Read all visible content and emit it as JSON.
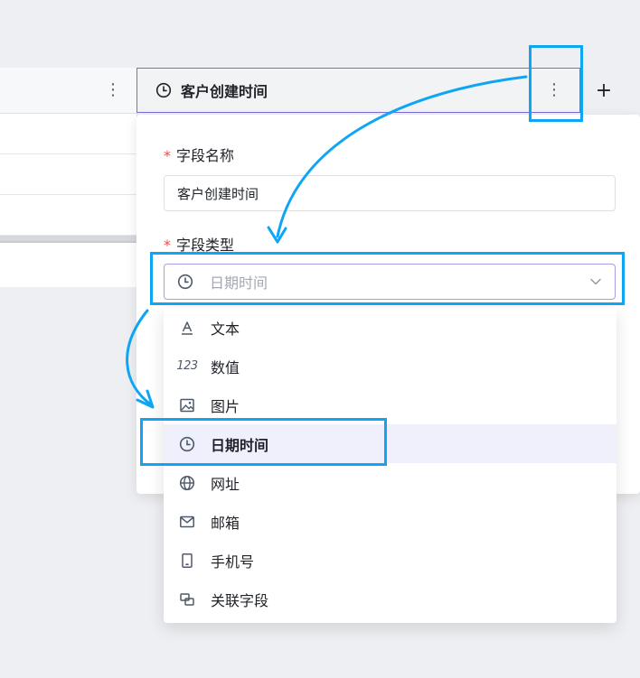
{
  "column": {
    "title": "客户创建时间",
    "add_label": "+"
  },
  "left_table": {
    "more_label": "⋮"
  },
  "popover": {
    "name_label": "字段名称",
    "name_value": "客户创建时间",
    "type_label": "字段类型",
    "type_placeholder": "日期时间",
    "required_mark": "*"
  },
  "field_types": [
    {
      "label": "文本",
      "icon": "text-icon"
    },
    {
      "label": "数值",
      "icon": "number-icon",
      "glyph": "123"
    },
    {
      "label": "图片",
      "icon": "image-icon"
    },
    {
      "label": "日期时间",
      "icon": "clock-icon",
      "selected": true
    },
    {
      "label": "网址",
      "icon": "globe-icon"
    },
    {
      "label": "邮箱",
      "icon": "mail-icon"
    },
    {
      "label": "手机号",
      "icon": "phone-icon"
    },
    {
      "label": "关联字段",
      "icon": "link-field-icon"
    }
  ],
  "colors": {
    "accent": "#7c6bd6",
    "highlight": "#0ea5f4",
    "selected_bg": "#f0effc",
    "required": "#f54a45"
  }
}
